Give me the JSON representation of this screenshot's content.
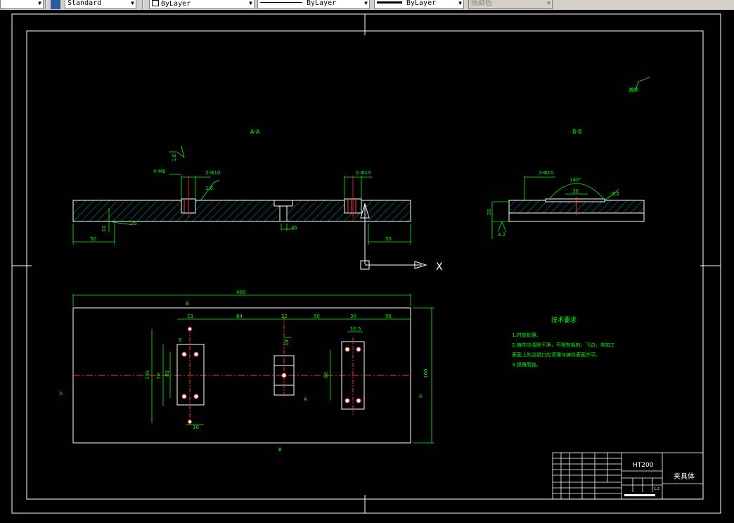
{
  "toolbar": {
    "text_style": "Standard",
    "layer_color": "ByLayer",
    "linetype": "ByLayer",
    "lineweight": "ByLayer",
    "plot_style": "随颜色"
  },
  "drawing": {
    "section_aa_label": "A-A",
    "section_bb_label": "B-B",
    "surface_note": "其余",
    "tech_req_title": "技术要求",
    "tech_req_items": [
      "1.时效处理。",
      "2.铸件应清除干净，不得有毛刺、飞边，非加工",
      "表面上的浇冒口应清理与铸件表面齐平。",
      "3.锐角倒钝。"
    ],
    "dims": {
      "overall_length": "400",
      "overall_width": "160",
      "left_offset": "50",
      "right_offset": "50",
      "thickness": "30",
      "d23": "23",
      "d84": "84",
      "d22": "22",
      "d50": "50",
      "d30": "30",
      "d56": "56",
      "d136": "136",
      "d70": "70",
      "d80": "80",
      "d16": "16",
      "d8": "8",
      "d10": "10",
      "d18": "18",
      "d12_5": "12.5",
      "d3_2": "3.2",
      "d1_6": "1.6",
      "d140": "140°",
      "d2x10": "2-Φ10",
      "d4xm": "4-M8",
      "d30b": "30",
      "d25": "25",
      "d45": "45",
      "d5": "5"
    },
    "section_marks": {
      "a": "A",
      "b": "B"
    },
    "axis_x": "X"
  },
  "title_block": {
    "material": "HT200",
    "part_name": "夹具体",
    "ratio": "1:2"
  }
}
